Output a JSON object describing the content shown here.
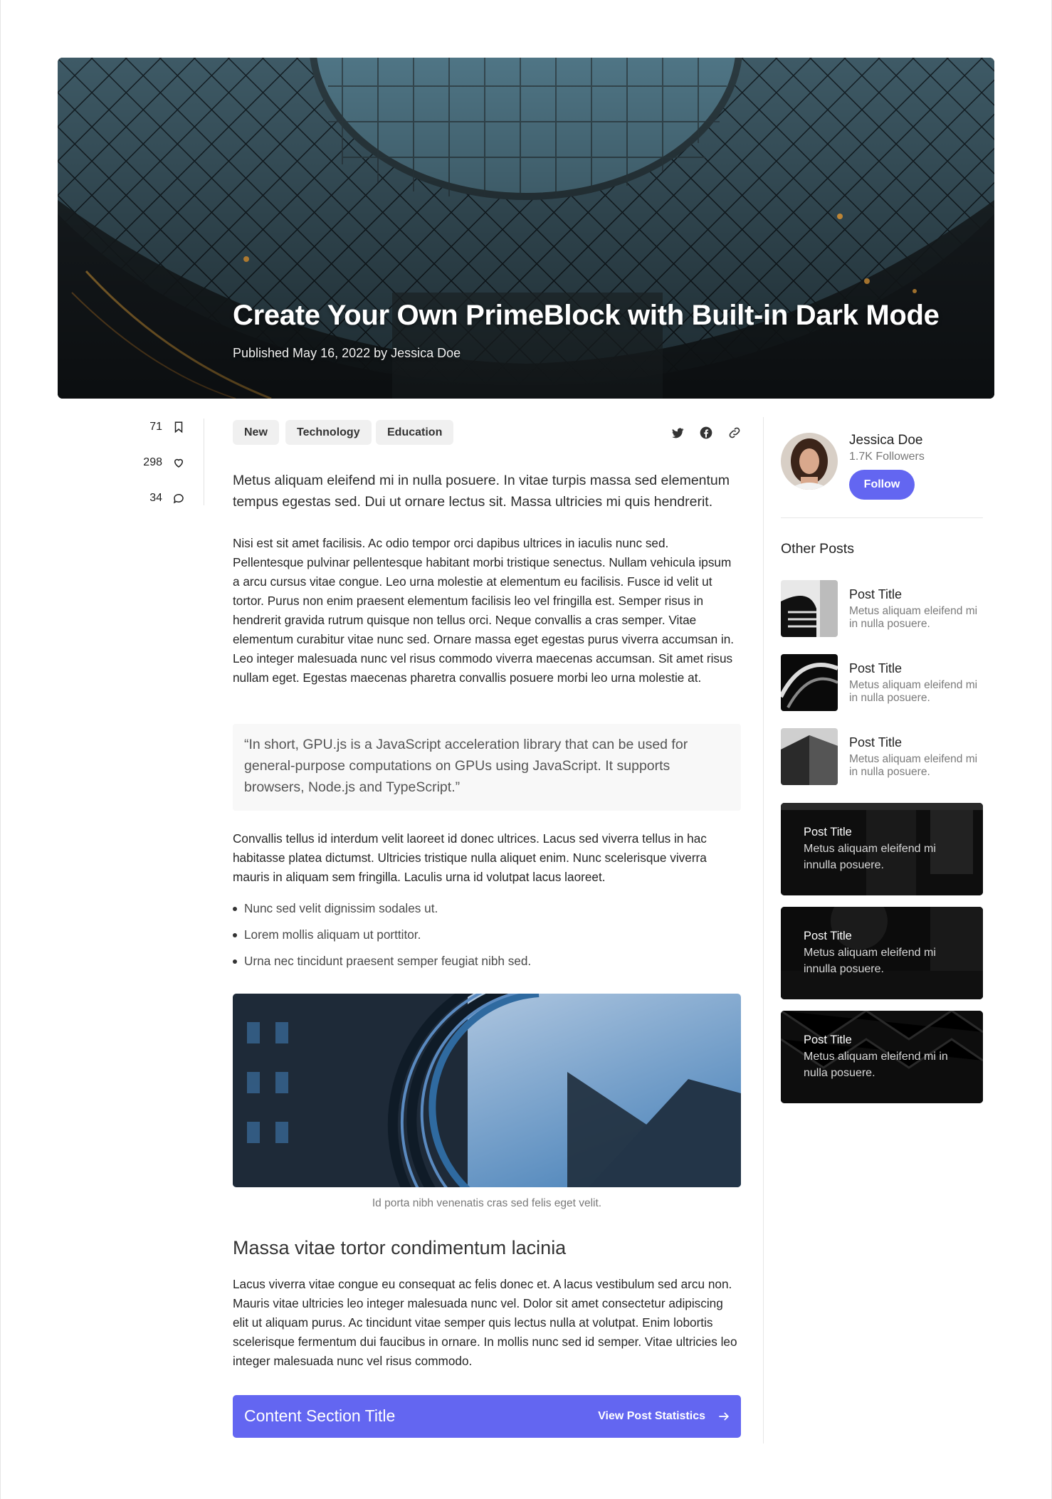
{
  "hero": {
    "title": "Create Your Own PrimeBlock with Built-in Dark Mode",
    "meta": "Published May 16, 2022 by Jessica Doe"
  },
  "stats": [
    {
      "value": "71",
      "icon": "bookmark-icon"
    },
    {
      "value": "298",
      "icon": "heart-icon"
    },
    {
      "value": "34",
      "icon": "comment-icon"
    }
  ],
  "tags": [
    "New",
    "Technology",
    "Education"
  ],
  "share_icons": [
    "twitter-icon",
    "facebook-icon",
    "link-icon"
  ],
  "article": {
    "lead": "Metus aliquam eleifend mi in nulla posuere. In vitae turpis massa sed elementum tempus egestas sed. Dui ut ornare lectus sit. Massa ultricies mi quis hendrerit.",
    "p1": "Nisi est sit amet facilisis. Ac odio tempor orci dapibus ultrices in iaculis nunc sed. Pellentesque pulvinar pellentesque habitant morbi tristique senectus. Nullam vehicula ipsum a arcu cursus vitae congue. Leo urna molestie at elementum eu facilisis. Fusce id velit ut tortor. Purus non enim praesent elementum facilisis leo vel fringilla est. Semper risus in hendrerit gravida rutrum quisque non tellus orci. Neque convallis a cras semper. Vitae elementum curabitur vitae nunc sed. Ornare massa eget egestas purus viverra accumsan in. Leo integer malesuada nunc vel risus commodo viverra maecenas accumsan. Sit amet risus nullam eget. Egestas maecenas pharetra convallis posuere morbi leo urna molestie at.",
    "quote": "“In short, GPU.js is a JavaScript acceleration library that can be used for general-purpose computations on GPUs using JavaScript. It supports browsers, Node.js and TypeScript.”",
    "p2": "Convallis tellus id interdum velit laoreet id donec ultrices. Lacus sed viverra tellus in hac habitasse platea dictumst. Ultricies tristique nulla aliquet enim. Nunc scelerisque viverra mauris in aliquam sem fringilla. Laculis urna id volutpat lacus laoreet.",
    "bullets": [
      "Nunc sed velit dignissim sodales ut.",
      "Lorem mollis aliquam ut porttitor.",
      "Urna nec tincidunt praesent semper feugiat nibh sed."
    ],
    "caption": "Id porta nibh venenatis cras sed felis eget velit.",
    "section_heading": "Massa vitae tortor condimentum lacinia",
    "p3": "Lacus viverra vitae congue eu consequat ac felis donec et. A lacus vestibulum sed arcu non. Mauris vitae ultricies leo integer malesuada nunc vel. Dolor sit amet consectetur adipiscing elit ut aliquam purus. Ac tincidunt vitae semper quis lectus nulla at volutpat. Enim lobortis scelerisque fermentum dui faucibus in ornare. In mollis nunc sed id semper. Vitae ultricies leo integer malesuada nunc vel risus commodo."
  },
  "cta": {
    "title": "Content Section Title",
    "link": "View Post Statistics"
  },
  "author": {
    "name": "Jessica Doe",
    "followers": "1.7K Followers",
    "follow_label": "Follow"
  },
  "other_posts": {
    "title": "Other Posts",
    "items": [
      {
        "title": "Post Title",
        "sub": "Metus aliquam eleifend mi in nulla posuere."
      },
      {
        "title": "Post Title",
        "sub": "Metus aliquam eleifend mi in nulla posuere."
      },
      {
        "title": "Post Title",
        "sub": "Metus aliquam eleifend mi in nulla posuere."
      }
    ],
    "cards": [
      {
        "title": "Post Title",
        "sub": "Metus aliquam eleifend mi innulla posuere."
      },
      {
        "title": "Post Title",
        "sub": "Metus aliquam eleifend mi innulla posuere."
      },
      {
        "title": "Post Title",
        "sub": "Metus aliquam eleifend mi in nulla posuere."
      }
    ]
  },
  "colors": {
    "accent": "#6366f1",
    "tag_bg": "#f0f0f0",
    "quote_bg": "#f8f8f8"
  }
}
